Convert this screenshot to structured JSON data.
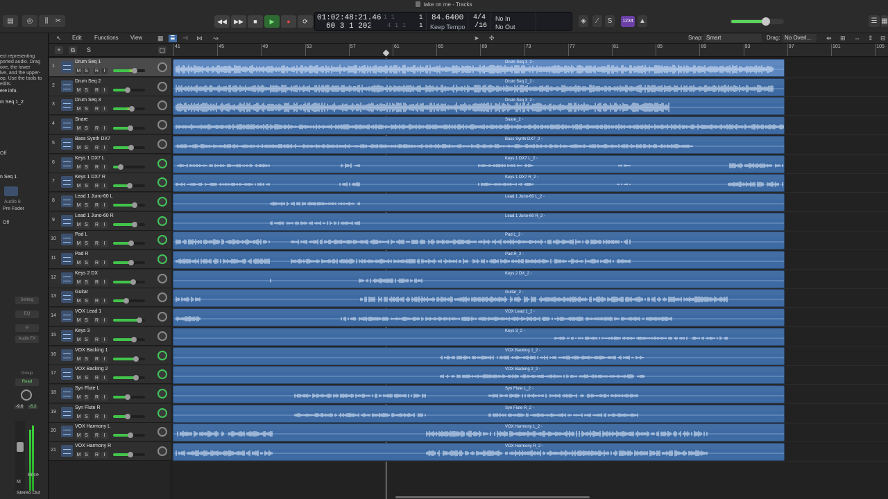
{
  "window": {
    "title": "take on me - Tracks"
  },
  "lcd": {
    "time": "01:02:48:21.46",
    "bars_top_dim": "1 1 1",
    "bars_top_val": "1",
    "position": "60  3  1  202",
    "bars_bottom_dim": "4  1  1",
    "bars_bottom_val": "1",
    "tempo": "84.6400",
    "tempo_mode": "Keep Tempo",
    "signature": "4/4",
    "division": "/16",
    "in": "No In",
    "out": "No Out"
  },
  "tuner_label": "1234",
  "master_volume_level": 0.68,
  "inspector": {
    "help_text": "ect representing\nported audio. Drag\nove, the lower\nlve, and the upper-\nop. Use the tools to\nedits.",
    "more_info": "ere info.",
    "region_name": "m Seq 1_2",
    "off_1": "Off",
    "track_name": "n Seq 1",
    "audio_label": "Audio 8",
    "pre_fader": "Pre Fader",
    "off_2": "Off",
    "setting": "Setting",
    "eq": "EQ",
    "audio_fx": "Audio FX",
    "group": "Group",
    "read": "Read",
    "vol_left": "-9.6",
    "vol_right": "-5.2",
    "m_btn": "M",
    "bnce": "Bnce",
    "stereo_out": "Stereo Out"
  },
  "toolbar": {
    "edit": "Edit",
    "functions": "Functions",
    "view": "View",
    "snap_label": "Snap:",
    "snap_value": "Smart",
    "drag_label": "Drag:",
    "drag_value": "No Overl..."
  },
  "header_buttons": {
    "add": "+",
    "duplicate": "⧉",
    "s": "S"
  },
  "ruler": {
    "bars": [
      "41",
      "45",
      "49",
      "53",
      "57",
      "61",
      "65",
      "69",
      "73",
      "77",
      "81",
      "85",
      "89",
      "93",
      "97",
      "101",
      "105"
    ]
  },
  "tracks": [
    {
      "num": "1",
      "name": "Drum Seq 1",
      "region": "Drum Seq 1_2",
      "vol": 0.7,
      "pan_green": false,
      "meter": true,
      "selected": true
    },
    {
      "num": "2",
      "name": "Drum Seq 2",
      "region": "Drum Seq 2_2",
      "vol": 0.48,
      "pan_green": false,
      "meter": false,
      "selected": false
    },
    {
      "num": "3",
      "name": "Drum Seq 3",
      "region": "Drum Seq 3_2",
      "vol": 0.62,
      "pan_green": false,
      "meter": true,
      "selected": false
    },
    {
      "num": "4",
      "name": "Snare",
      "region": "Snare_2",
      "vol": 0.56,
      "pan_green": false,
      "meter": false,
      "selected": false
    },
    {
      "num": "5",
      "name": "Bass Synth DX7",
      "region": "Bass Synth DX7_2",
      "vol": 0.58,
      "pan_green": false,
      "meter": false,
      "selected": false
    },
    {
      "num": "6",
      "name": "Keys 1 DX7 L",
      "region": "Keys 1 DX7 L_2",
      "vol": 0.24,
      "pan_green": true,
      "meter": false,
      "selected": false
    },
    {
      "num": "7",
      "name": "Keys 1 DX7 R",
      "region": "Keys 1 DX7 R_2",
      "vol": 0.54,
      "pan_green": true,
      "meter": false,
      "selected": false
    },
    {
      "num": "8",
      "name": "Lead 1 Juno-60 L",
      "region": "Lead 1 Juno-60 L_2",
      "vol": 0.7,
      "pan_green": true,
      "meter": false,
      "selected": false
    },
    {
      "num": "9",
      "name": "Lead 1 Juno-60 R",
      "region": "Lead 1 Juno-60 R_2",
      "vol": 0.7,
      "pan_green": true,
      "meter": false,
      "selected": false
    },
    {
      "num": "10",
      "name": "Pad L",
      "region": "Pad L_2",
      "vol": 0.6,
      "pan_green": true,
      "meter": false,
      "selected": false
    },
    {
      "num": "11",
      "name": "Pad R",
      "region": "Pad R_2",
      "vol": 0.6,
      "pan_green": true,
      "meter": false,
      "selected": false
    },
    {
      "num": "12",
      "name": "Keys 2 DX",
      "region": "Keys 2 DX_2",
      "vol": 0.66,
      "pan_green": false,
      "meter": false,
      "selected": false
    },
    {
      "num": "13",
      "name": "Guitar",
      "region": "Guitar_2",
      "vol": 0.44,
      "pan_green": false,
      "meter": false,
      "selected": false
    },
    {
      "num": "14",
      "name": "VOX Lead 1",
      "region": "VOX Lead 1_2",
      "vol": 0.86,
      "pan_green": false,
      "meter": false,
      "selected": false
    },
    {
      "num": "15",
      "name": "Keys 3",
      "region": "Keys 3_2",
      "vol": 0.68,
      "pan_green": false,
      "meter": false,
      "selected": false
    },
    {
      "num": "16",
      "name": "VOX Backing 1",
      "region": "VOX Backing 1_2",
      "vol": 0.76,
      "pan_green": true,
      "meter": false,
      "selected": false
    },
    {
      "num": "17",
      "name": "VOX Backing 2",
      "region": "VOX Backing 2_2",
      "vol": 0.76,
      "pan_green": true,
      "meter": false,
      "selected": false
    },
    {
      "num": "18",
      "name": "Syn Flute L",
      "region": "Syn Flute L_2",
      "vol": 0.48,
      "pan_green": true,
      "meter": false,
      "selected": false
    },
    {
      "num": "19",
      "name": "Syn Flute R",
      "region": "Syn Flute R_2",
      "vol": 0.48,
      "pan_green": true,
      "meter": false,
      "selected": false
    },
    {
      "num": "20",
      "name": "VOX Harmony L",
      "region": "VOX Harmony L_2",
      "vol": 0.56,
      "pan_green": false,
      "meter": false,
      "selected": false
    },
    {
      "num": "21",
      "name": "VOX Harmony R",
      "region": "VOX Harmony R_2",
      "vol": 0.56,
      "pan_green": false,
      "meter": false,
      "selected": false
    }
  ],
  "colors": {
    "region": "#3d6aa2",
    "region_selected": "#5b86bf",
    "volume_green": "#42c44b",
    "tuner": "#6a3fa6"
  }
}
